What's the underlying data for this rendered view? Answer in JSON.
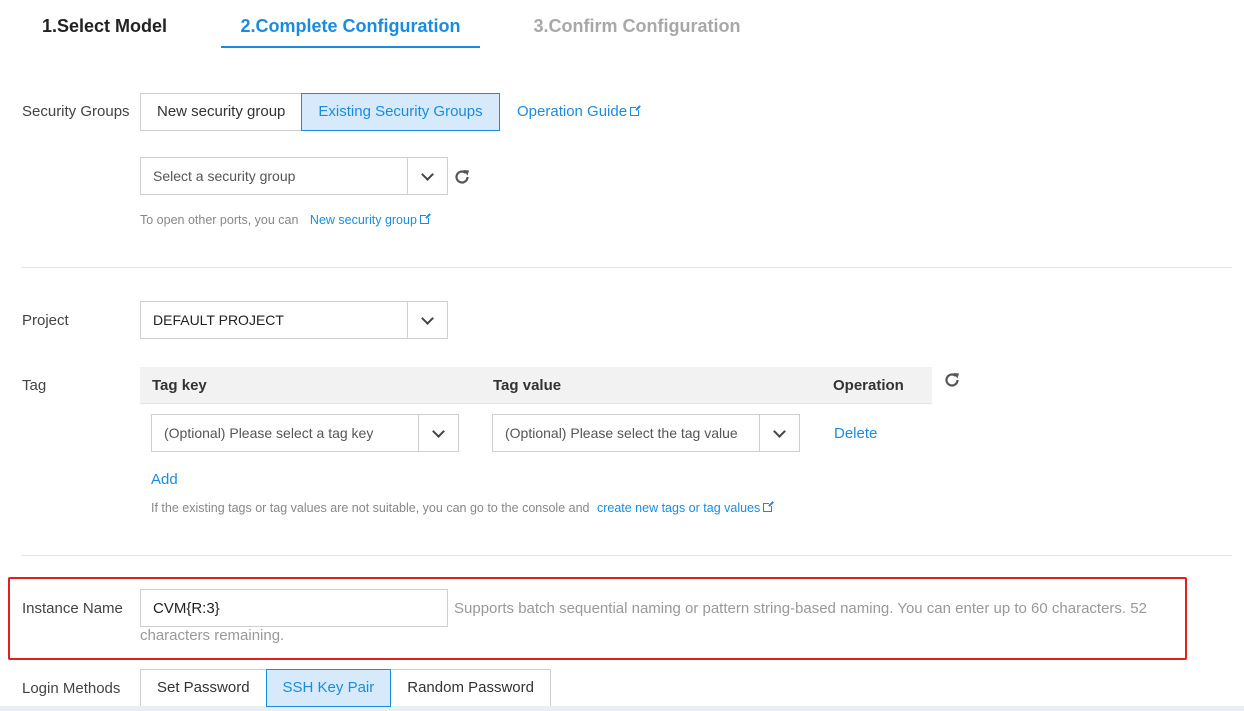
{
  "steps": [
    "1.Select Model",
    "2.Complete Configuration",
    "3.Confirm Configuration"
  ],
  "security_groups": {
    "label": "Security Groups",
    "options": [
      "New security group",
      "Existing Security Groups"
    ],
    "active_option": "Existing Security Groups",
    "guide_link": "Operation Guide",
    "select_placeholder": "Select a security group",
    "hint_text": "To open other ports, you can",
    "hint_link": "New security group"
  },
  "project": {
    "label": "Project",
    "value": "DEFAULT PROJECT"
  },
  "tag": {
    "label": "Tag",
    "columns": [
      "Tag key",
      "Tag value",
      "Operation"
    ],
    "row": {
      "key_placeholder": "(Optional) Please select a tag key",
      "value_placeholder": "(Optional) Please select the tag value",
      "delete_label": "Delete"
    },
    "add_label": "Add",
    "hint_text": "If the existing tags or tag values are not suitable, you can go to the console and",
    "hint_link": "create new tags or tag values"
  },
  "instance_name": {
    "label": "Instance Name",
    "value": "CVM{R:3}",
    "hint_line1": "Supports batch sequential naming or pattern string-based naming. You can enter up to 60 characters. 52",
    "hint_line2": "characters remaining."
  },
  "login_methods": {
    "label": "Login Methods",
    "options": [
      "Set Password",
      "SSH Key Pair",
      "Random Password"
    ],
    "active_option": "SSH Key Pair"
  },
  "colors": {
    "accent": "#1a8ce0",
    "active_fill": "#d6eafb",
    "highlight_border": "#e02020"
  }
}
